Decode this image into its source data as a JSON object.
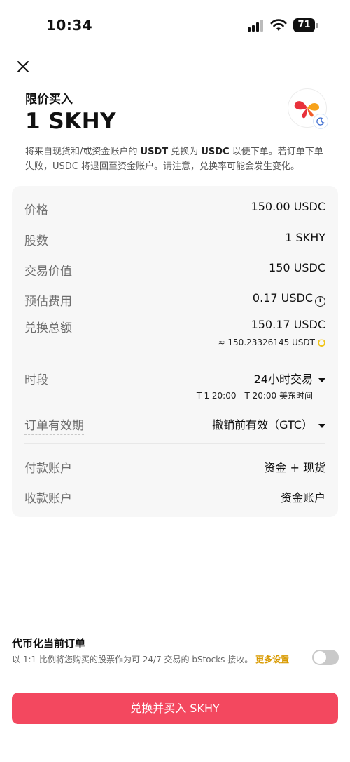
{
  "status_bar": {
    "time": "10:34",
    "battery": "71"
  },
  "header": {
    "label": "限价买入",
    "title": "1 SKHY"
  },
  "notice": {
    "part1": "将来自现货和/或资金账户的 ",
    "from": "USDT",
    "part2": " 兑换为 ",
    "to": "USDC",
    "part3": " 以便下单。若订单下单失败，USDC 将退回至资金账户。请注意，兑换率可能会发生变化。"
  },
  "details": {
    "price": {
      "label": "价格",
      "value": "150.00 USDC"
    },
    "shares": {
      "label": "股数",
      "value": "1 SKHY"
    },
    "trade_value": {
      "label": "交易价值",
      "value": "150 USDC"
    },
    "est_fee": {
      "label": "预估费用",
      "value": "0.17 USDC"
    },
    "total": {
      "label": "兑换总额",
      "value": "150.17 USDC",
      "approx": "≈ 150.23326145 USDT"
    },
    "session": {
      "label": "时段",
      "value": "24小时交易",
      "hours": "T-1 20:00 - T 20:00 美东时间"
    },
    "validity": {
      "label": "订单有效期",
      "value": "撤销前有效（GTC）"
    },
    "pay_account": {
      "label": "付款账户",
      "value": "资金 + 现货"
    },
    "receive_account": {
      "label": "收款账户",
      "value": "资金账户"
    }
  },
  "tokenize": {
    "title": "代币化当前订单",
    "desc": "以 1:1 比例将您购买的股票作为可 24/7 交易的 bStocks 接收。",
    "link": "更多设置",
    "enabled": false
  },
  "cta": {
    "label": "兑换并买入 SKHY"
  },
  "colors": {
    "cta": "#f3485f",
    "link": "#d99a00",
    "card_bg": "#f7f7f7",
    "logo_red": "#e8313b",
    "logo_orange": "#f7a21b"
  },
  "icons": [
    "close-icon",
    "info-icon",
    "loading-icon",
    "chevron-down-icon",
    "moon-icon"
  ]
}
